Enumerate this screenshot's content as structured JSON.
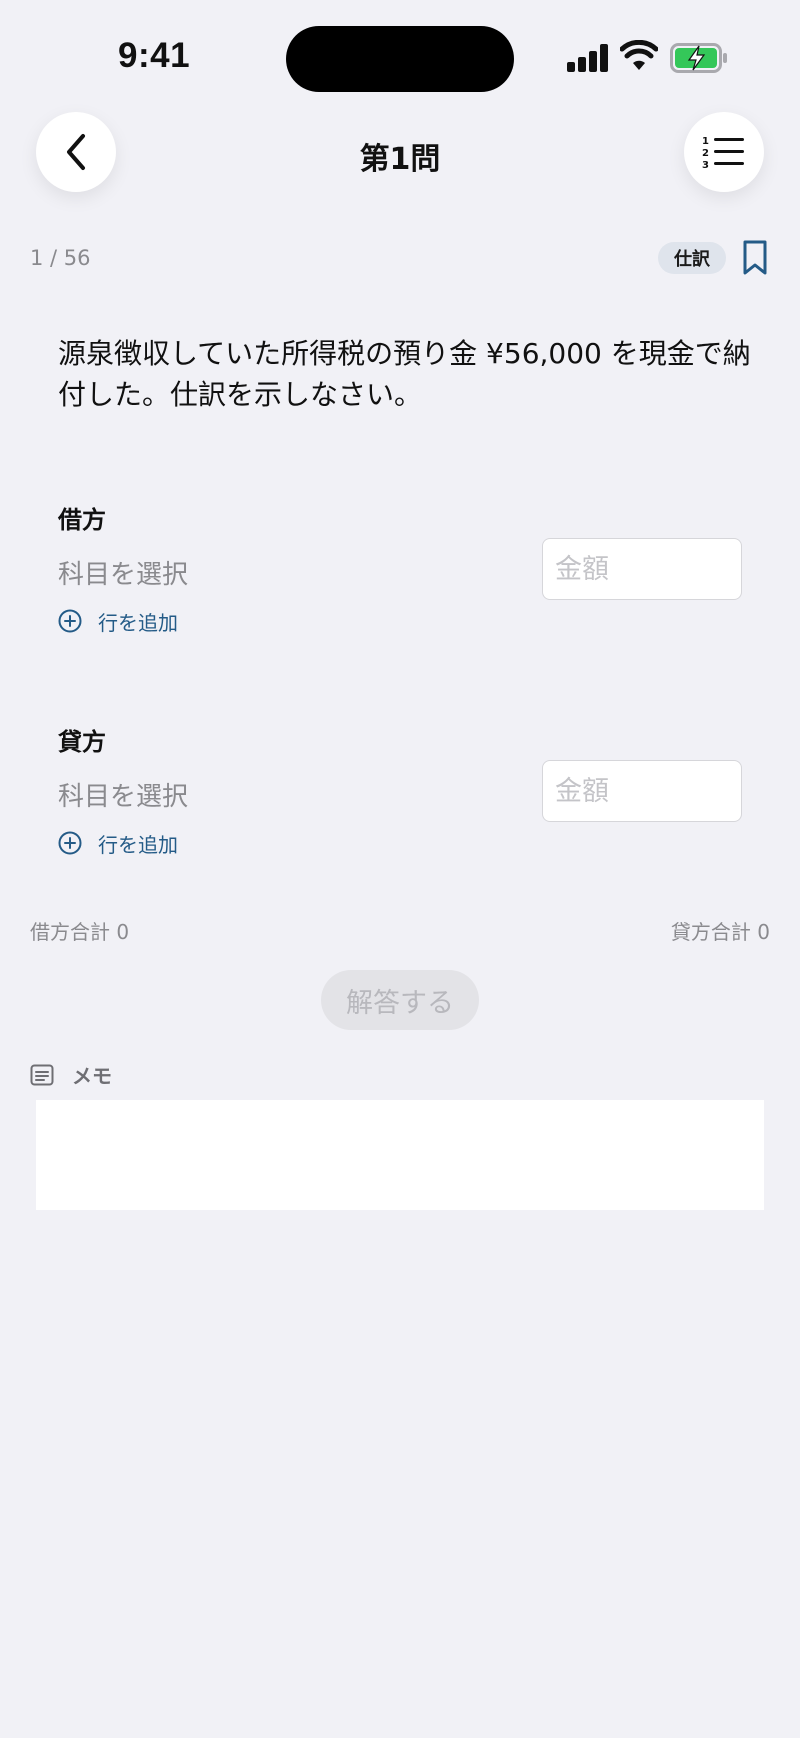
{
  "status_bar": {
    "time": "9:41"
  },
  "nav": {
    "title": "第1問",
    "back_icon": "chevron-left-icon",
    "list_icon": "numbered-list-icon"
  },
  "progress": {
    "text": "1 / 56"
  },
  "tag": {
    "label": "仕訳"
  },
  "question": {
    "text": "源泉徴収していた所得税の預り金 ¥56,000 を現金で納付した。仕訳を示しなさい。"
  },
  "debit": {
    "label": "借方",
    "account_placeholder": "科目を選択",
    "amount_placeholder": "金額",
    "add_row_label": "行を追加"
  },
  "credit": {
    "label": "貸方",
    "account_placeholder": "科目を選択",
    "amount_placeholder": "金額",
    "add_row_label": "行を追加"
  },
  "totals": {
    "debit_total": "借方合計 0",
    "credit_total": "貸方合計 0"
  },
  "submit": {
    "label": "解答する"
  },
  "memo": {
    "label": "メモ",
    "value": ""
  },
  "colors": {
    "accent": "#245b87",
    "background": "#f1f1f6",
    "battery": "#34c759"
  }
}
